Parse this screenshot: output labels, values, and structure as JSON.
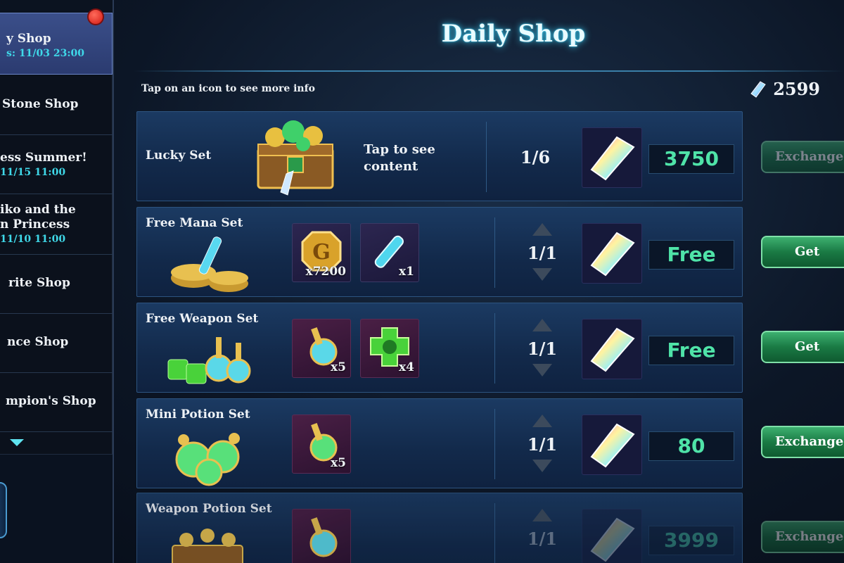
{
  "sidebar": {
    "items": [
      {
        "title": "y Shop",
        "sub": "s: 11/03 23:00"
      },
      {
        "title": "Stone Shop",
        "sub": ""
      },
      {
        "title": "ess Summer!",
        "sub": "11/15 11:00"
      },
      {
        "title": "iko and the",
        "title2": "n Princess",
        "sub": "11/10 11:00"
      },
      {
        "title": "rite Shop",
        "sub": ""
      },
      {
        "title": "nce Shop",
        "sub": ""
      },
      {
        "title": "mpion's Shop",
        "sub": ""
      }
    ]
  },
  "header": {
    "title": "Daily Shop",
    "hint": "Tap on an icon to see more info",
    "currency_amount": "2599"
  },
  "rows": [
    {
      "name": "Lucky Set",
      "content_label_1": "Tap to see",
      "content_label_2": "content",
      "count": "1/6",
      "price": "3750",
      "button": "Exchange"
    },
    {
      "name": "Free Mana Set",
      "items": [
        {
          "qty": "x7200"
        },
        {
          "qty": "x1"
        }
      ],
      "count": "1/1",
      "price": "Free",
      "button": "Get"
    },
    {
      "name": "Free Weapon Set",
      "items": [
        {
          "qty": "x5"
        },
        {
          "qty": "x4"
        }
      ],
      "count": "1/1",
      "price": "Free",
      "button": "Get"
    },
    {
      "name": "Mini Potion Set",
      "items": [
        {
          "qty": "x5"
        }
      ],
      "count": "1/1",
      "price": "80",
      "button": "Exchange"
    },
    {
      "name": "Weapon Potion Set",
      "items": [
        {
          "qty": ""
        }
      ],
      "count": "1/1",
      "price": "3999",
      "button": "Exchange"
    }
  ],
  "colors": {
    "accent_cyan": "#3ed8ff",
    "price_green": "#4fe3a8",
    "button_green": "#1a7a44",
    "notification_red": "#d21a14"
  },
  "icons": [
    "gem-icon",
    "gold-coin-icon",
    "mana-vial-icon",
    "potion-icon",
    "weapon-crest-icon",
    "treasure-chest-icon",
    "chevron-down-icon",
    "arrow-up-icon",
    "arrow-down-icon"
  ]
}
